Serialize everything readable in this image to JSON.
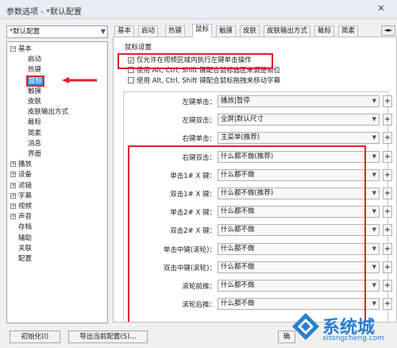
{
  "window": {
    "title": "参数选项 - *默认配置",
    "close_label": "✕"
  },
  "preset": {
    "value": "*默认配置"
  },
  "tree": [
    {
      "label": "基本",
      "type": "expanded"
    },
    {
      "label": "启动",
      "type": "child"
    },
    {
      "label": "热键",
      "type": "child"
    },
    {
      "label": "鼠标",
      "type": "child",
      "selected": true
    },
    {
      "label": "触摸",
      "type": "child"
    },
    {
      "label": "皮肤",
      "type": "child"
    },
    {
      "label": "皮肤输出方式",
      "type": "child"
    },
    {
      "label": "截标",
      "type": "child"
    },
    {
      "label": "简素",
      "type": "child"
    },
    {
      "label": "消息",
      "type": "child"
    },
    {
      "label": "界面",
      "type": "child"
    },
    {
      "label": "播放",
      "type": "collapsed"
    },
    {
      "label": "设备",
      "type": "collapsed"
    },
    {
      "label": "滤镜",
      "type": "collapsed"
    },
    {
      "label": "字幕",
      "type": "collapsed"
    },
    {
      "label": "视频",
      "type": "collapsed"
    },
    {
      "label": "声音",
      "type": "collapsed"
    },
    {
      "label": "存档",
      "type": "leaf"
    },
    {
      "label": "辅助",
      "type": "leaf"
    },
    {
      "label": "关联",
      "type": "leaf"
    },
    {
      "label": "配置",
      "type": "leaf"
    }
  ],
  "tabs": [
    "基本",
    "启动",
    "热键",
    "鼠标",
    "触摸",
    "皮肤",
    "皮肤输出方式",
    "截标",
    "简素"
  ],
  "tab_nav": "◄►",
  "mouse": {
    "group_label": "鼠标设置",
    "checkboxes": [
      {
        "label": "仅允许在视频区域内执行左键单击操作",
        "checked": true
      },
      {
        "label": "使用 Alt, Ctrl, Shift 键配合鼠标选区来调整帧位",
        "checked": false
      },
      {
        "label": "使用 Alt, Ctrl, Shift 键配合鼠标拖拽来移动字幕",
        "checked": false
      }
    ],
    "rows": [
      {
        "label": "左键单击：",
        "value": "播放|暂停"
      },
      {
        "label": "左键双击：",
        "value": "全屏|默认尺寸"
      },
      {
        "label": "右键单击：",
        "value": "主菜单(推荐)"
      },
      {
        "label": "右键双击：",
        "value": "什么都不做(推荐)"
      },
      {
        "label": "单击1# X 键：",
        "value": "什么都不做"
      },
      {
        "label": "双击1# X 键：",
        "value": "什么都不做(推荐)"
      },
      {
        "label": "单击2# X 键：",
        "value": "什么都不做"
      },
      {
        "label": "双击2# X 键：",
        "value": "什么都不做"
      },
      {
        "label": "单击中键(滚轮)：",
        "value": "什么都不做"
      },
      {
        "label": "双击中键(滚轮)：",
        "value": "什么都不做"
      },
      {
        "label": "滚轮前推：",
        "value": "什么都不做"
      },
      {
        "label": "滚轮后推：",
        "value": "什么都不做"
      }
    ],
    "plus_label": "+"
  },
  "buttons": {
    "init": "初始化(I)",
    "export": "导出当前配置(S)...",
    "ok": "确"
  },
  "watermark": {
    "brand": "系统城",
    "url": "xitongcheng.com"
  },
  "colors": {
    "highlight": "#e0202a",
    "selection": "#3399ff"
  }
}
